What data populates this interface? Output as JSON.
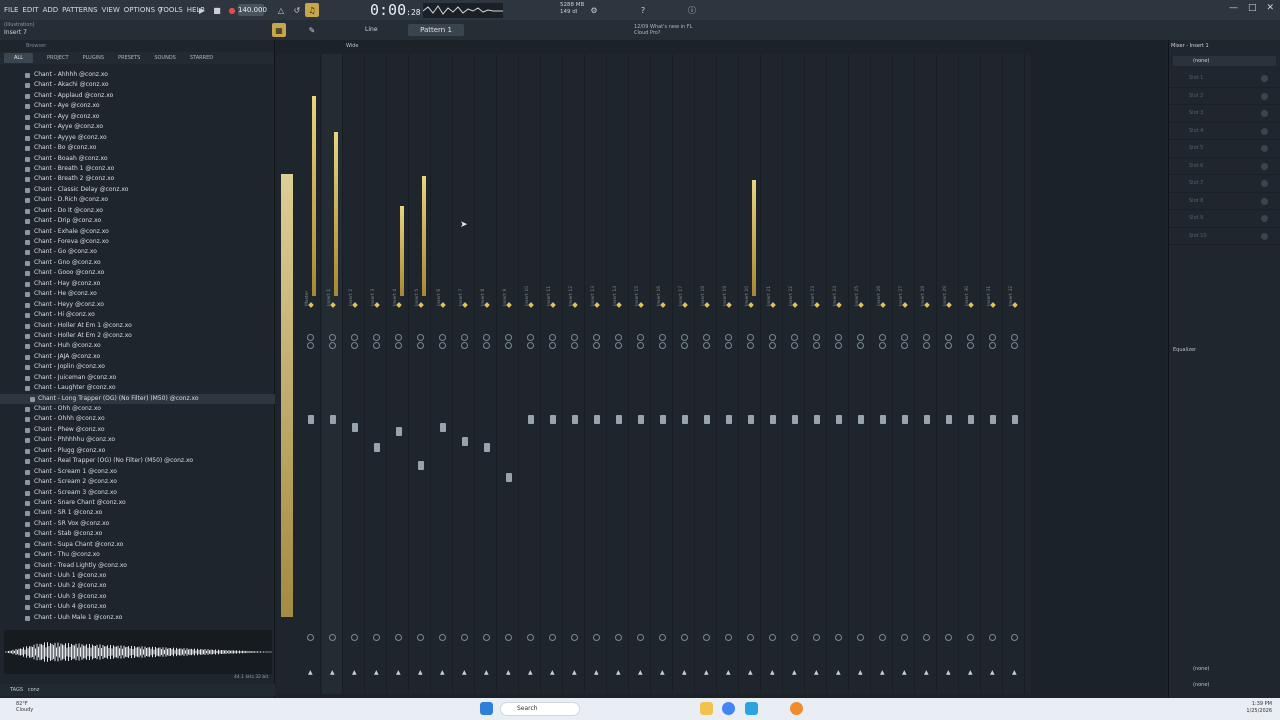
{
  "menu": [
    "FILE",
    "EDIT",
    "ADD",
    "PATTERNS",
    "VIEW",
    "OPTIONS",
    "TOOLS",
    "HELP"
  ],
  "tempo": "140.000",
  "time": {
    "main": "0:00",
    "sub": "28"
  },
  "cpu": {
    "line1": "5288 MB",
    "line2": "149 dl"
  },
  "hint": {
    "line1": "(Illustration)",
    "line2": "Insert 7"
  },
  "pattern_label": "Pattern 1",
  "snap_label": "Line",
  "view_label": "Wide",
  "news": {
    "line1": "12/09  What's new in FL",
    "line2": "Cloud Pro?"
  },
  "browser": {
    "title": "Browser",
    "tabs": [
      "ALL",
      "PROJECT",
      "PLUGINS",
      "PRESETS",
      "SOUNDS",
      "STARRED"
    ],
    "files": [
      "Chant - Ahhhh @conz.xo",
      "Chant - Akachi @conz.xo",
      "Chant - Applaud @conz.xo",
      "Chant - Aye @conz.xo",
      "Chant - Ayy @conz.xo",
      "Chant - Ayye @conz.xo",
      "Chant - Ayyye @conz.xo",
      "Chant - Bo @conz.xo",
      "Chant - Boaah @conz.xo",
      "Chant - Breath 1 @conz.xo",
      "Chant - Breath 2 @conz.xo",
      "Chant - Classic Delay @conz.xo",
      "Chant - D.Rich @conz.xo",
      "Chant - Do It @conz.xo",
      "Chant - Drip @conz.xo",
      "Chant - Exhale @conz.xo",
      "Chant - Foreva @conz.xo",
      "Chant - Go @conz.xo",
      "Chant - Gno @conz.xo",
      "Chant - Gooo @conz.xo",
      "Chant - Hay @conz.xo",
      "Chant - He @conz.xo",
      "Chant - Heyy @conz.xo",
      "Chant - Hi @conz.xo",
      "Chant - Holler At Em 1 @conz.xo",
      "Chant - Holler At Em 2 @conz.xo",
      "Chant - Huh @conz.xo",
      "Chant - JAJA @conz.xo",
      "Chant - Joplin @conz.xo",
      "Chant - Juiceman @conz.xo",
      "Chant - Laughter @conz.xo",
      "Chant - Long Trapper (OG) (No Filter) (M50) @conz.xo",
      "Chant - Ohh @conz.xo",
      "Chant - Ohhh @conz.xo",
      "Chant - Phew @conz.xo",
      "Chant - Phhhhhu @conz.xo",
      "Chant - Plugg @conz.xo",
      "Chant - Real Trapper (OG) (No Filter) (M50) @conz.xo",
      "Chant - Scream 1 @conz.xo",
      "Chant - Scream 2 @conz.xo",
      "Chant - Scream 3 @conz.xo",
      "Chant - Snare Chant @conz.xo",
      "Chant - SR 1 @conz.xo",
      "Chant - SR Vox @conz.xo",
      "Chant - Stab @conz.xo",
      "Chant - Supa Chant @conz.xo",
      "Chant - Thu @conz.xo",
      "Chant - Tread Lightly @conz.xo",
      "Chant - Uuh 1 @conz.xo",
      "Chant - Uuh 2 @conz.xo",
      "Chant - Uuh 3 @conz.xo",
      "Chant - Uuh 4 @conz.xo",
      "Chant - Uuh Male 1 @conz.xo"
    ],
    "selected_index": 31,
    "waveform_info": "44.1 kHz 32 bit",
    "tags_label": "TAGS",
    "tags_value": "conz"
  },
  "mixer": {
    "strips": [
      "Master",
      "Insert 1",
      "Insert 2",
      "Insert 3",
      "Insert 4",
      "Insert 5",
      "Insert 6",
      "Insert 7",
      "Insert 8",
      "Insert 9",
      "Insert 10",
      "Insert 11",
      "Insert 12",
      "Insert 13",
      "Insert 14",
      "Insert 15",
      "Insert 16",
      "Insert 17",
      "Insert 18",
      "Insert 19",
      "Insert 20",
      "Insert 21",
      "Insert 22",
      "Insert 23",
      "Insert 24",
      "Insert 25",
      "Insert 26",
      "Insert 27",
      "Insert 28",
      "Insert 29",
      "Insert 30",
      "Insert 31",
      "Insert 32"
    ],
    "meter_levels": [
      1.0,
      0.82,
      0.0,
      0.0,
      0.45,
      0.6,
      0.0,
      0.0,
      0.0,
      0.0,
      0.0,
      0.0,
      0.0,
      0.0,
      0.0,
      0.0,
      0.0,
      0.0,
      0.0,
      0.0,
      0.58,
      0.0,
      0.0,
      0.0,
      0.0,
      0.0,
      0.0,
      0.0,
      0.0,
      0.0,
      0.0,
      0.0,
      0.0
    ],
    "fader_levels": [
      0.78,
      0.78,
      0.72,
      0.55,
      0.68,
      0.4,
      0.72,
      0.6,
      0.55,
      0.3,
      0.78,
      0.78,
      0.78,
      0.78,
      0.78,
      0.78,
      0.78,
      0.78,
      0.78,
      0.78,
      0.78,
      0.78,
      0.78,
      0.78,
      0.78,
      0.78,
      0.78,
      0.78,
      0.78,
      0.78,
      0.78,
      0.78,
      0.78
    ],
    "selected_index": 1
  },
  "right_panel": {
    "title": "Mixer - Insert 1",
    "input": "(none)",
    "slots": [
      "Slot 1",
      "Slot 2",
      "Slot 3",
      "Slot 4",
      "Slot 5",
      "Slot 6",
      "Slot 7",
      "Slot 8",
      "Slot 9",
      "Slot 10"
    ],
    "eq_label": "Equalizer",
    "output1": "(none)",
    "output2": "(none)"
  },
  "taskbar": {
    "temp": "82°F",
    "condition": "Cloudy",
    "search": "Search",
    "time": "1:39 PM",
    "date": "1/25/2026"
  },
  "colors": {
    "meter": "#e3c15c",
    "bg": "#1d242b",
    "taskbar": "#e9eef5"
  }
}
